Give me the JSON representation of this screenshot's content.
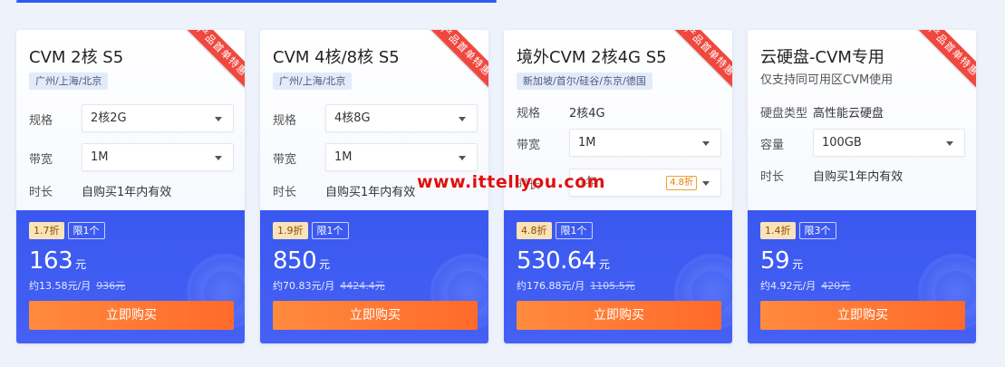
{
  "ribbon_text": "产品首单特惠",
  "buy_label": "立即购买",
  "watermark": "www.ittellyou.com",
  "cards": [
    {
      "title": "CVM 2核 S5",
      "region": "广州/上海/北京",
      "rows": [
        {
          "label": "规格",
          "value": "2核2G"
        },
        {
          "label": "带宽",
          "value": "1M"
        },
        {
          "label": "时长",
          "value": "自购买1年内有效"
        }
      ],
      "discount": "1.7折",
      "limit": "限1个",
      "price": "163",
      "unit": "元",
      "per_month": "约13.58元/月",
      "original": "936元"
    },
    {
      "title": "CVM 4核/8核 S5",
      "region": "广州/上海/北京",
      "rows": [
        {
          "label": "规格",
          "value": "4核8G"
        },
        {
          "label": "带宽",
          "value": "1M"
        },
        {
          "label": "时长",
          "value": "自购买1年内有效"
        }
      ],
      "discount": "1.9折",
      "limit": "限1个",
      "price": "850",
      "unit": "元",
      "per_month": "约70.83元/月",
      "original": "4424.4元"
    },
    {
      "title": "境外CVM 2核4G S5",
      "region": "新加坡/首尔/硅谷/东京/德国",
      "rows": [
        {
          "label": "规格",
          "value": "2核4G"
        },
        {
          "label": "带宽",
          "value": "1M"
        },
        {
          "label": "时长",
          "value": "1年"
        }
      ],
      "select_badge": "4.8折",
      "discount": "4.8折",
      "limit": "限1个",
      "price": "530.64",
      "unit": "元",
      "per_month": "约176.88元/月",
      "original": "1105.5元"
    },
    {
      "title": "云硬盘-CVM专用",
      "subtitle": "仅支持同可用区CVM使用",
      "rows": [
        {
          "label": "硬盘类型",
          "value": "高性能云硬盘"
        },
        {
          "label": "容量",
          "value": "100GB"
        },
        {
          "label": "时长",
          "value": "自购买1年内有效"
        }
      ],
      "discount": "1.4折",
      "limit": "限3个",
      "price": "59",
      "unit": "元",
      "per_month": "约4.92元/月",
      "original": "420元"
    }
  ]
}
